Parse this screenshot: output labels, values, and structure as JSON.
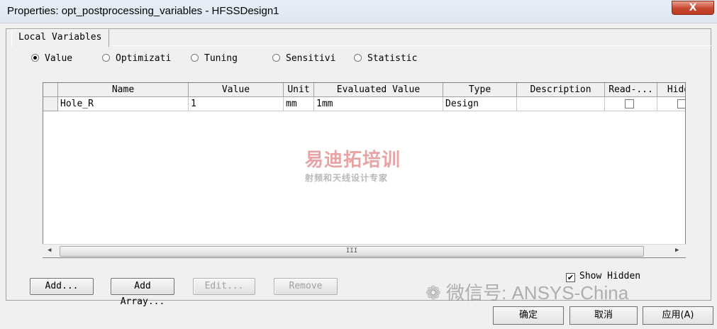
{
  "window": {
    "title": "Properties: opt_postprocessing_variables - HFSSDesign1",
    "close_label": "X"
  },
  "tabs": [
    {
      "label": "Local Variables"
    }
  ],
  "radios": [
    {
      "label": "Value",
      "selected": true
    },
    {
      "label": "Optimizati",
      "selected": false
    },
    {
      "label": "Tuning",
      "selected": false
    },
    {
      "label": "Sensitivi",
      "selected": false
    },
    {
      "label": "Statistic",
      "selected": false
    }
  ],
  "table": {
    "columns": [
      "Name",
      "Value",
      "Unit",
      "Evaluated Value",
      "Type",
      "Description",
      "Read-...",
      "Hidd"
    ],
    "rows": [
      {
        "name": "Hole_R",
        "value": "1",
        "unit": "mm",
        "evaluated": "1mm",
        "type": "Design",
        "description": "",
        "read_only": false,
        "hidden": false
      }
    ],
    "scroll_thumb_label": "III"
  },
  "buttons": {
    "add": "Add...",
    "add_array": "Add Array...",
    "edit": "Edit...",
    "remove": "Remove"
  },
  "show_hidden": {
    "label": "Show Hidden",
    "checked": true,
    "mark": "✔"
  },
  "watermark": {
    "brand": "易迪拓培训",
    "tagline": "射频和天线设计专家",
    "wechat": "微信号: ANSYS-China"
  },
  "footer": {
    "ok": "确定",
    "cancel": "取消",
    "apply": "应用(A)"
  }
}
